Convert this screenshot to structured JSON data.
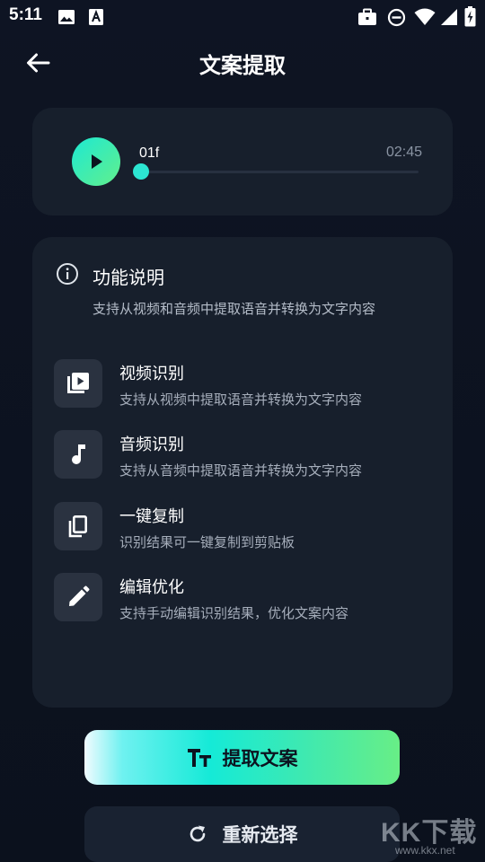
{
  "status_bar": {
    "time": "5:11",
    "left_icons": [
      "image-icon",
      "text-a-icon"
    ],
    "right_icons": [
      "briefcase-icon",
      "do-not-disturb-icon",
      "wifi-icon",
      "signal-icon",
      "battery-charging-icon"
    ]
  },
  "header": {
    "back_icon": "arrow-left-icon",
    "title": "文案提取"
  },
  "player": {
    "play_icon": "play-icon",
    "file_name": "01f",
    "duration": "02:45",
    "progress_fraction": 0.0
  },
  "info": {
    "icon": "info-icon",
    "title": "功能说明",
    "description": "支持从视频和音频中提取语音并转换为文字内容",
    "features": [
      {
        "icon": "video-play-icon",
        "title": "视频识别",
        "desc": "支持从视频中提取语音并转换为文字内容"
      },
      {
        "icon": "music-note-icon",
        "title": "音频识别",
        "desc": "支持从音频中提取语音并转换为文字内容"
      },
      {
        "icon": "copy-icon",
        "title": "一键复制",
        "desc": "识别结果可一键复制到剪贴板"
      },
      {
        "icon": "edit-pencil-icon",
        "title": "编辑优化",
        "desc": "支持手动编辑识别结果，优化文案内容"
      }
    ]
  },
  "actions": {
    "extract_label": "提取文案",
    "extract_icon": "text-size-icon",
    "reselect_label": "重新选择",
    "reselect_icon": "refresh-icon"
  },
  "watermark": {
    "main": "KK下载",
    "sub": "www.kkx.net"
  },
  "colors": {
    "background": "#0d1320",
    "card": "#171f2c",
    "accent_start": "#1de9d3",
    "accent_end": "#68ee86"
  }
}
